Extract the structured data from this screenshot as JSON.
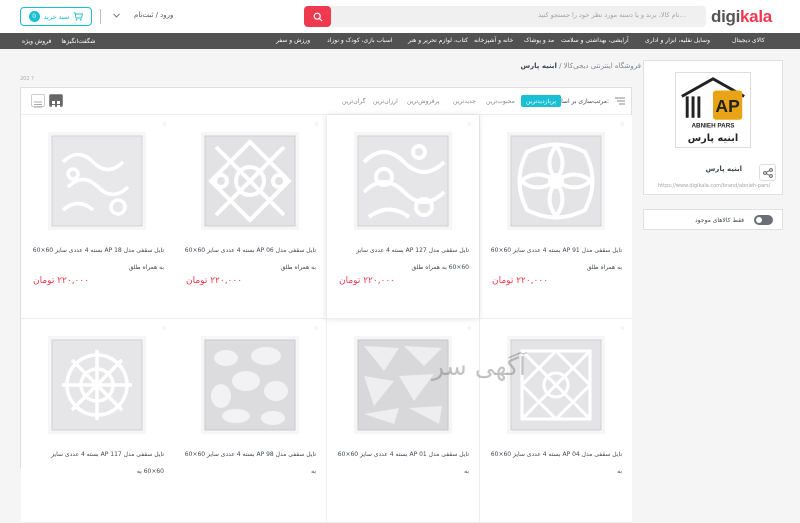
{
  "header": {
    "logo_a": "digi",
    "logo_b": "kala",
    "search_placeholder": "نام کالا، برند و یا دسته مورد نظر خود را جستجو کنید…",
    "cart_label": "سبد خرید",
    "cart_count": "0",
    "login_label": "ورود / ثبت‌نام"
  },
  "nav": {
    "items": [
      "کالای دیجیتال",
      "وسایل نقلیه، ابزار و اداری",
      "آرایشی، بهداشتی و سلامت",
      "مد و پوشاک",
      "خانه و آشپزخانه",
      "کتاب، لوازم تحریر و هنر",
      "اسباب بازی، کودک و نوزاد",
      "ورزش و سفر"
    ],
    "left_items": [
      "شگفت‌انگیزها",
      "فروش ویژه"
    ]
  },
  "breadcrumb": {
    "parent": "فروشگاه اینترنتی دیجی‌کالا",
    "separator": "/",
    "current": "ابنیه پارس"
  },
  "results_count": "202 ?",
  "sort": {
    "label": "مرتب‌سازی بر اساس:",
    "active": "پربازدیدترین",
    "options": [
      "محبوب‌ترین",
      "جدیدترین",
      "پرفروش‌ترین",
      "ارزان‌ترین",
      "گران‌ترین"
    ]
  },
  "products": [
    {
      "title": "تایل سقفی مدل AP 91 بسته 4 عددی سایز 60×60 به همراه طلق",
      "price": "۲۲۰,۰۰۰ تومان"
    },
    {
      "title": "تایل سقفی مدل AP 127 بسته 4 عددی سایز 60×60 به همراه طلق",
      "price": "۲۲۰,۰۰۰ تومان"
    },
    {
      "title": "تایل سقفی مدل AP 06 بسته 4 عددی سایز 60×60 به همراه طلق",
      "price": "۲۲۰,۰۰۰ تومان"
    },
    {
      "title": "تایل سقفی مدل AP 18 بسته 4 عددی سایز 60×60 به همراه طلق",
      "price": "۲۲۰,۰۰۰ تومان"
    },
    {
      "title": "تایل سقفی مدل AP 04 بسته 4 عددی سایز 60×60 به",
      "price": ""
    },
    {
      "title": "تایل سقفی مدل AP 01 بسته 4 عددی سایز 60×60 به",
      "price": ""
    },
    {
      "title": "تایل سقفی مدل AP 98 بسته 4 عددی سایز 60×60 به",
      "price": ""
    },
    {
      "title": "تایل سقفی مدل AP 117 بسته 4 عددی سایز 60×60 به",
      "price": ""
    }
  ],
  "brand": {
    "logo_text_top": "ABNIEH PARS",
    "logo_text_fa": "ابنیه پارس",
    "logo_letters": "AP",
    "name": "ابنیه پارس",
    "url": "https://www.digikala.com/brand/abnieh-pars/"
  },
  "filter": {
    "label": "فقط کالاهای موجود"
  },
  "watermark": "آگهی سر",
  "colors": {
    "accent": "#19bfd3",
    "brand": "#ef394e",
    "nav": "#525252"
  }
}
